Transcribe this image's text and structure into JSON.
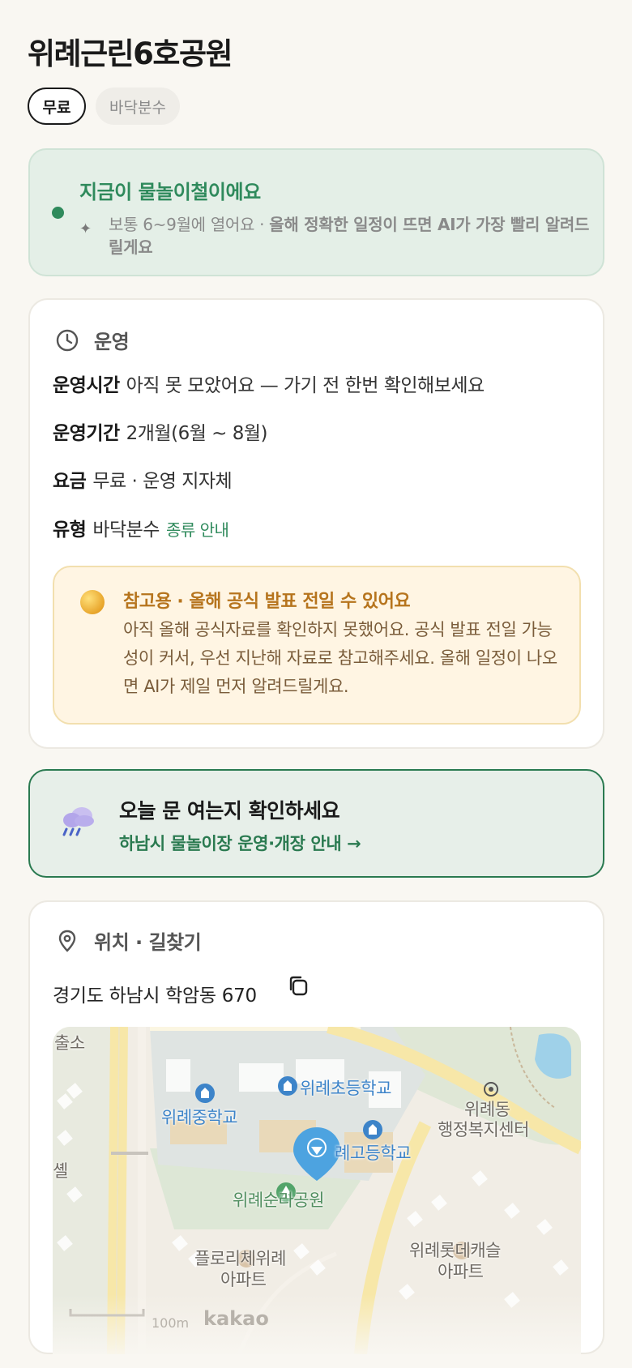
{
  "title": "위례근린6호공원",
  "chips": {
    "free": "무료",
    "type": "바닥분수"
  },
  "season": {
    "title": "지금이 물놀이철이에요",
    "desc_plain": "보통 6~9월에 열어요 · ",
    "desc_bold": "올해 정확한 일정이 뜨면 AI가 가장 빨리 알려드릴게요"
  },
  "ops": {
    "heading": "운영",
    "hours_key": "운영시간",
    "hours_val": "아직 못 모았어요 — 가기 전 한번 확인해보세요",
    "period_key": "운영기간",
    "period_val": "2개월(6월 ~ 8월)",
    "fee_key": "요금",
    "fee_val": "무료 · 운영 지자체",
    "type_key": "유형",
    "type_val": "바닥분수",
    "type_link": "종류 안내",
    "notice_title": "참고용 · 올해 공식 발표 전일 수 있어요",
    "notice_body": "아직 올해 공식자료를 확인하지 못했어요. 공식 발표 전일 가능성이 커서, 우선 지난해 자료로 참고해주세요. 올해 일정이 나오면 AI가 제일 먼저 알려드릴게요."
  },
  "cta": {
    "title": "오늘 문 여는지 확인하세요",
    "link": "하남시 물놀이장 운영·개장 안내 →"
  },
  "location": {
    "heading": "위치 · 길찾기",
    "address": "경기도 하남시 학암동 670",
    "map_labels": {
      "police": "출소",
      "middle_school": "위례중학교",
      "elementary_school": "위례초등학교",
      "high_school": "례고등학교",
      "community_center_1": "위례동",
      "community_center_2": "행정복지센터",
      "park": "위례순라공원",
      "apt1_1": "플로리체위례",
      "apt1_2": "아파트",
      "apt2_1": "위례롯데캐슬",
      "apt2_2": "아파트",
      "edge": "셸"
    },
    "scale": "100m",
    "provider": "kakao"
  }
}
